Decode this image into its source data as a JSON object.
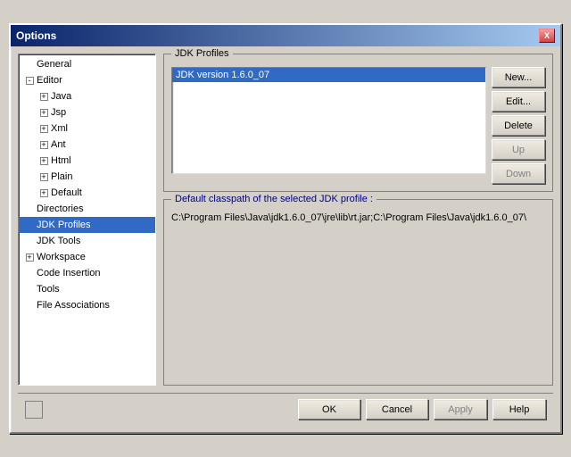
{
  "window": {
    "title": "Options",
    "close_label": "X"
  },
  "tree": {
    "items": [
      {
        "id": "general",
        "label": "General",
        "indent": 1,
        "expandable": false,
        "selected": false
      },
      {
        "id": "editor",
        "label": "Editor",
        "indent": 1,
        "expandable": true,
        "expanded": true,
        "selected": false
      },
      {
        "id": "java",
        "label": "Java",
        "indent": 2,
        "expandable": true,
        "selected": false
      },
      {
        "id": "jsp",
        "label": "Jsp",
        "indent": 2,
        "expandable": true,
        "selected": false
      },
      {
        "id": "xml",
        "label": "Xml",
        "indent": 2,
        "expandable": true,
        "selected": false
      },
      {
        "id": "ant",
        "label": "Ant",
        "indent": 2,
        "expandable": true,
        "selected": false
      },
      {
        "id": "html",
        "label": "Html",
        "indent": 2,
        "expandable": true,
        "selected": false
      },
      {
        "id": "plain",
        "label": "Plain",
        "indent": 2,
        "expandable": true,
        "selected": false
      },
      {
        "id": "default",
        "label": "Default",
        "indent": 2,
        "expandable": true,
        "selected": false
      },
      {
        "id": "directories",
        "label": "Directories",
        "indent": 1,
        "expandable": false,
        "selected": false
      },
      {
        "id": "jdk-profiles",
        "label": "JDK Profiles",
        "indent": 1,
        "expandable": false,
        "selected": true
      },
      {
        "id": "jdk-tools",
        "label": "JDK Tools",
        "indent": 1,
        "expandable": false,
        "selected": false
      },
      {
        "id": "workspace",
        "label": "Workspace",
        "indent": 1,
        "expandable": true,
        "selected": false
      },
      {
        "id": "code-insertion",
        "label": "Code Insertion",
        "indent": 1,
        "expandable": false,
        "selected": false
      },
      {
        "id": "tools",
        "label": "Tools",
        "indent": 1,
        "expandable": false,
        "selected": false
      },
      {
        "id": "file-associations",
        "label": "File Associations",
        "indent": 1,
        "expandable": false,
        "selected": false
      }
    ]
  },
  "jdk_profiles": {
    "group_title": "JDK Profiles",
    "profiles": [
      {
        "id": "jdk-1.6.0_07",
        "label": "JDK version 1.6.0_07",
        "selected": true
      }
    ],
    "buttons": {
      "new_label": "New...",
      "edit_label": "Edit...",
      "delete_label": "Delete",
      "up_label": "Up",
      "down_label": "Down"
    }
  },
  "classpath": {
    "group_title": "Default classpath of the selected JDK profile :",
    "value": "C:\\Program Files\\Java\\jdk1.6.0_07\\jre\\lib\\rt.jar;C:\\Program Files\\Java\\jdk1.6.0_07\\"
  },
  "bottom_buttons": {
    "ok_label": "OK",
    "cancel_label": "Cancel",
    "apply_label": "Apply",
    "help_label": "Help"
  }
}
